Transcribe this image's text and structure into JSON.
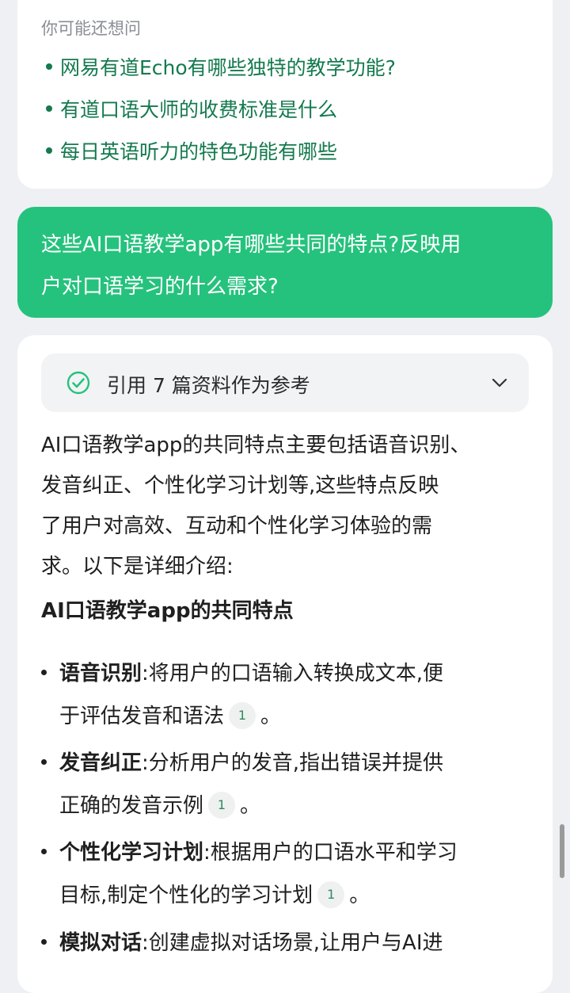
{
  "suggestions": {
    "heading": "你可能还想问",
    "items": [
      "网易有道Echo有哪些独特的教学功能?",
      "有道口语大师的收费标准是什么",
      "每日英语听力的特色功能有哪些"
    ]
  },
  "user_message": {
    "line1": "这些AI口语教学app有哪些共同的特点?反映用",
    "line2": "户对口语学习的什么需求?"
  },
  "references": {
    "label": "引用 7 篇资料作为参考"
  },
  "answer": {
    "intro_lines": [
      "AI口语教学app的共同特点主要包括语音识别、",
      "发音纠正、个性化学习计划等,这些特点反映",
      "了用户对高效、互动和个性化学习体验的需",
      "求。以下是详细介绍:"
    ],
    "section_heading": "AI口语教学app的共同特点",
    "bullets": [
      {
        "term": "语音识别",
        "line1": ":将用户的口语输入转换成文本,便",
        "line2": "于评估发音和语法",
        "cite": "1",
        "end": "。"
      },
      {
        "term": "发音纠正",
        "line1": ":分析用户的发音,指出错误并提供",
        "line2": "正确的发音示例",
        "cite": "1",
        "end": "。"
      },
      {
        "term": "个性化学习计划",
        "line1": ":根据用户的口语水平和学习",
        "line2": "目标,制定个性化的学习计划",
        "cite": "1",
        "end": "。"
      },
      {
        "term": "模拟对话",
        "line1": ":创建虚拟对话场景,让用户与AI进"
      }
    ]
  },
  "colors": {
    "accent_green": "#25c27d",
    "link_green": "#147a4e",
    "background": "#eef0f3"
  },
  "icons": {
    "reference_status": "check-circle-icon",
    "expand": "chevron-down-icon"
  }
}
